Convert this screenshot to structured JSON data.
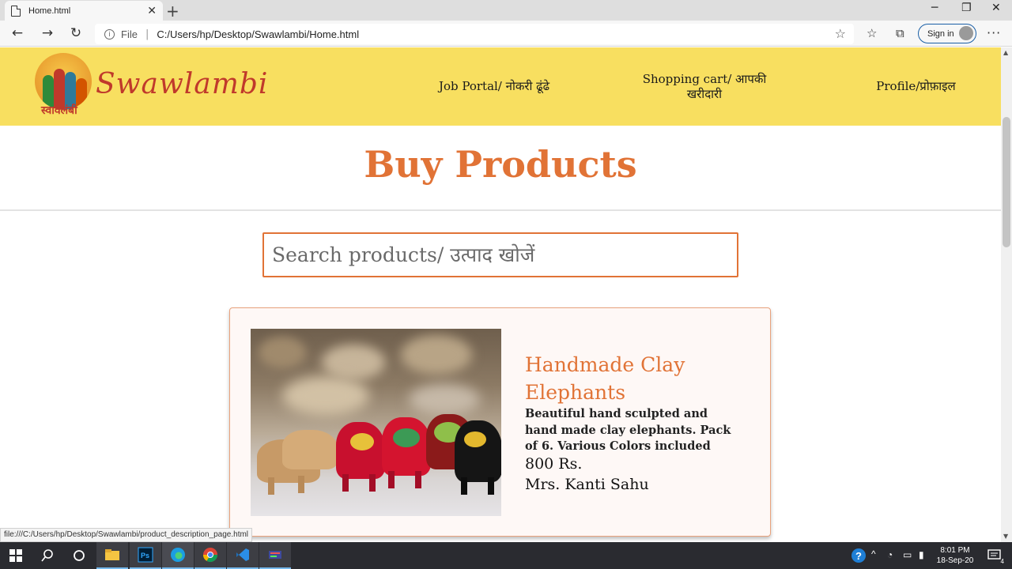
{
  "browser": {
    "tab_title": "Home.html",
    "address_scheme": "File",
    "address_url": "C:/Users/hp/Desktop/Swawlambi/Home.html",
    "sign_in_label": "Sign in",
    "status_url": "file:///C:/Users/hp/Desktop/Swawlambi/product_description_page.html"
  },
  "site": {
    "brand": "Swawlambi",
    "logo_hindi": "स्वावलंबी",
    "nav": [
      {
        "label": "Job Portal/ नोकरी ढूंढे"
      },
      {
        "label": "Shopping cart/ आपकी खरीदारी"
      },
      {
        "label": "Profile/प्रोफ़ाइल"
      }
    ]
  },
  "page": {
    "title": "Buy Products",
    "search_placeholder": "Search products/ उत्पाद खोजें"
  },
  "product": {
    "name": "Handmade Clay Elephants",
    "description": "Beautiful hand sculpted and hand made clay elephants. Pack of 6. Various Colors included",
    "price": "800 Rs.",
    "seller": "Mrs. Kanti Sahu"
  },
  "taskbar": {
    "time": "8:01 PM",
    "date": "18-Sep-20",
    "notification_count": "4"
  },
  "colors": {
    "header_bg": "#f8df60",
    "accent": "#e17336",
    "brand_red": "#c0392b"
  }
}
